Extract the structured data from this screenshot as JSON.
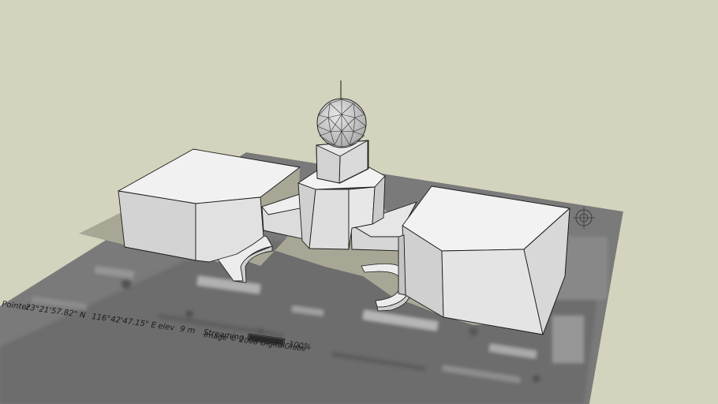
{
  "viewport": {
    "background_color": "#d4d3bd",
    "model_face_color": "#ececec",
    "model_shade_color": "#c9c9c9",
    "edge_color": "#1a1a1a",
    "shadow_color": "#a8a796"
  },
  "imagery_overlay": {
    "status_prefix": "Pointer",
    "latitude": "23°21'57.82\" N",
    "longitude": "116°42'47.15\" E",
    "elevation_label": "elev",
    "elevation_value": "9 m",
    "streaming_label": "Streaming",
    "streaming_percent": "100%",
    "streaming_progress": 1.0,
    "copyright": "Image © 2008 DigitalGlobe",
    "compass_icon": "compass-rose-icon"
  }
}
